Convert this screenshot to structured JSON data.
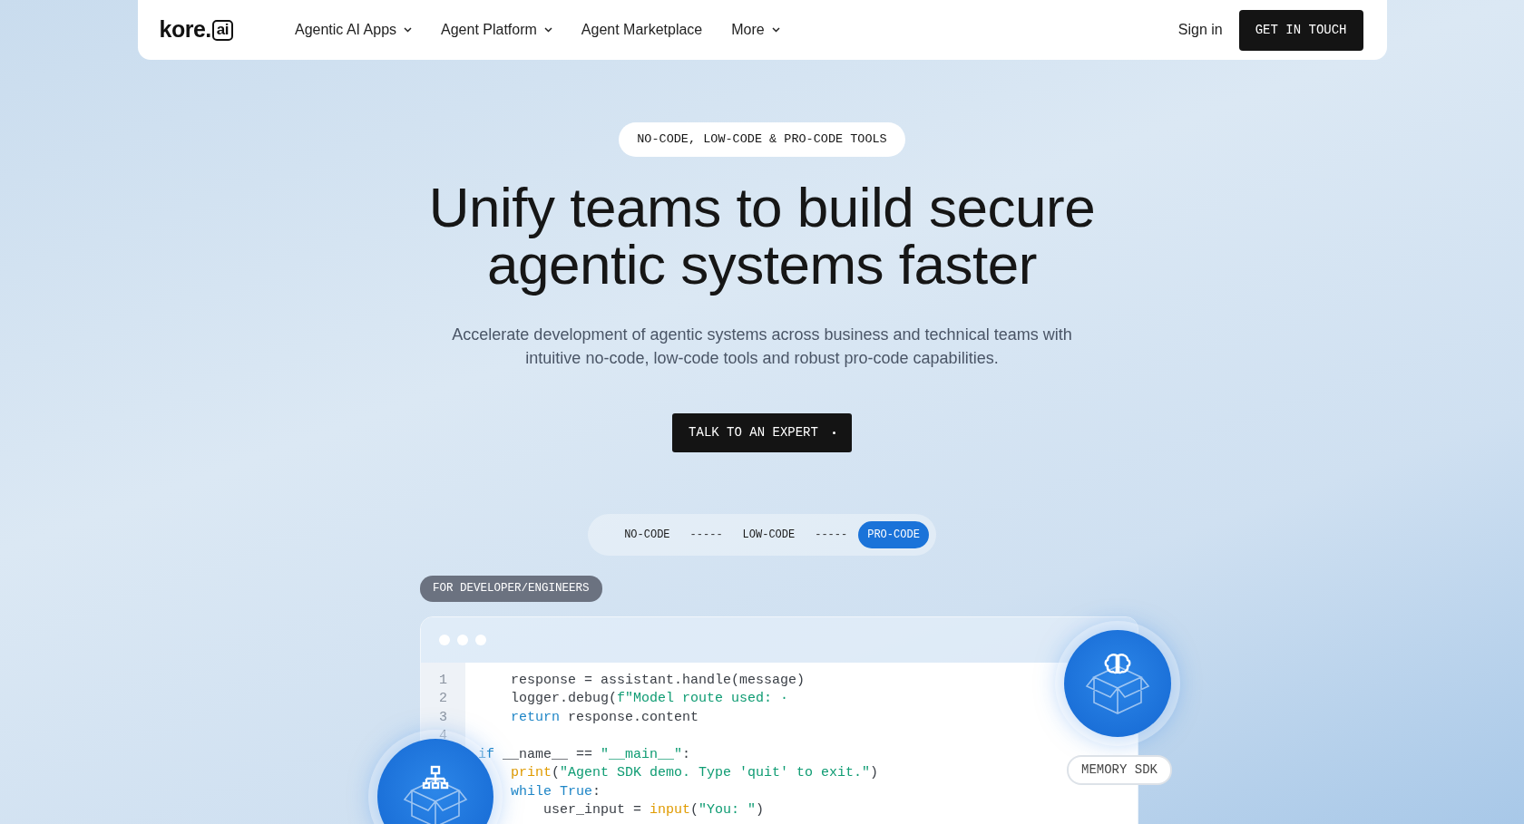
{
  "nav": {
    "logo": {
      "word": "kore.",
      "badge": "ai"
    },
    "links": [
      {
        "label": "Agentic AI Apps",
        "dropdown": true
      },
      {
        "label": "Agent Platform",
        "dropdown": true
      },
      {
        "label": "Agent Marketplace",
        "dropdown": false
      },
      {
        "label": "More",
        "dropdown": true
      }
    ],
    "sign_in": "Sign in",
    "cta": "GET IN TOUCH"
  },
  "hero": {
    "eyebrow": "NO-CODE, LOW-CODE & PRO-CODE TOOLS",
    "title_lines": [
      "Unify teams to build secure",
      "agentic systems faster"
    ],
    "subtitle": "Accelerate development of agentic systems across business and technical teams with intuitive no-code, low-code tools and robust pro-code capabilities.",
    "button": "TALK TO AN EXPERT"
  },
  "toggle": [
    {
      "kind": "step",
      "label": "NO-CODE",
      "selected": false
    },
    {
      "kind": "separator",
      "label": "-----"
    },
    {
      "kind": "step",
      "label": "LOW-CODE",
      "selected": false
    },
    {
      "kind": "separator",
      "label": "-----"
    },
    {
      "kind": "step",
      "label": "PRO-CODE",
      "selected": true
    }
  ],
  "audience_badge": "FOR DEVELOPER/ENGINEERS",
  "code": {
    "lines": [
      {
        "number": "1",
        "tokens": [
          {
            "kind": "plain",
            "text": "    response = assistant.handle(message)"
          }
        ]
      },
      {
        "number": "2",
        "tokens": [
          {
            "kind": "plain",
            "text": "    logger.debug("
          },
          {
            "kind": "string",
            "text": "f\"Model route used: ·"
          }
        ]
      },
      {
        "number": "3",
        "tokens": [
          {
            "kind": "keyword",
            "text": "    return"
          },
          {
            "kind": "plain",
            "text": " response.content"
          }
        ]
      },
      {
        "number": "4"
      },
      {
        "tokens": [
          {
            "kind": "keyword",
            "text": "if"
          },
          {
            "kind": "plain",
            "text": " __name__ == "
          },
          {
            "kind": "string",
            "text": "\"__main__\""
          },
          {
            "kind": "plain",
            "text": ":"
          }
        ]
      },
      {
        "tokens": [
          {
            "kind": "builtin",
            "text": "    print"
          },
          {
            "kind": "plain",
            "text": "("
          },
          {
            "kind": "string",
            "text": "\"Agent SDK demo. Type 'quit' to exit.\""
          },
          {
            "kind": "plain",
            "text": ")"
          }
        ]
      },
      {
        "tokens": [
          {
            "kind": "keyword",
            "text": "    while True"
          },
          {
            "kind": "plain",
            "text": ":"
          }
        ]
      },
      {
        "tokens": [
          {
            "kind": "plain",
            "text": "        user_input = "
          },
          {
            "kind": "builtin",
            "text": "input"
          },
          {
            "kind": "plain",
            "text": "("
          },
          {
            "kind": "string",
            "text": "\"You: \""
          },
          {
            "kind": "plain",
            "text": ")"
          }
        ]
      }
    ]
  },
  "medallions": [
    {
      "kind": "hierarchy"
    },
    {
      "kind": "brain",
      "label": "MEMORY SDK"
    }
  ]
}
